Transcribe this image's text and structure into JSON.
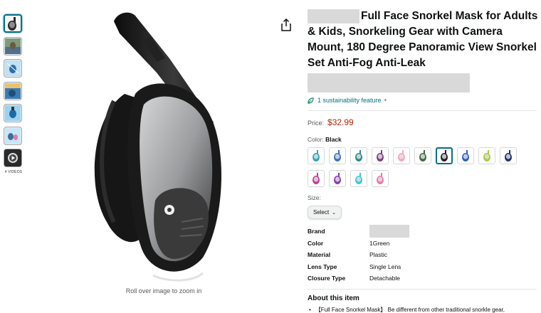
{
  "thumbnails": {
    "items": [
      {
        "name": "thumb-black-mask",
        "color": "#2b2b2b",
        "bg": "#f3f5f7"
      },
      {
        "name": "thumb-snorkeling-photo",
        "color": "#6b5a3d",
        "bg": "#7d9a7a"
      },
      {
        "name": "thumb-features-graphic",
        "color": "#2f6fb0",
        "bg": "#bfe1f2"
      },
      {
        "name": "thumb-underwater-photo",
        "color": "#1d4f7a",
        "bg": "#3c7bb0"
      },
      {
        "name": "thumb-camera-mount",
        "color": "#1b6aa6",
        "bg": "#9dd2ee"
      },
      {
        "name": "thumb-family-photo",
        "color": "#3b6f98",
        "bg": "#c8e6f5"
      }
    ],
    "videos_label": "4 VIDEOS"
  },
  "main_image": {
    "zoom_hint": "Roll over image to zoom in"
  },
  "product": {
    "title": "Full Face Snorkel Mask for Adults & Kids, Snorkeling Gear with Camera Mount, 180 Degree Panoramic View Snorkel Set Anti-Fog Anti-Leak",
    "sustainability": "1 sustainability feature",
    "price_label": "Price:",
    "price": "$32.99",
    "color_label": "Color:",
    "color_value": "Black",
    "size_label": "Size:",
    "size_select": "Select",
    "swatches": [
      {
        "name": "swatch-aqua",
        "color": "#2ea6b8"
      },
      {
        "name": "swatch-blue",
        "color": "#3f6fc2"
      },
      {
        "name": "swatch-teal-dark",
        "color": "#2f8c8c"
      },
      {
        "name": "swatch-purple-black",
        "color": "#7a3f7d"
      },
      {
        "name": "swatch-pink-light",
        "color": "#f2a7c6"
      },
      {
        "name": "swatch-green-black",
        "color": "#3d6b3d"
      },
      {
        "name": "swatch-black",
        "color": "#1f1f1f"
      },
      {
        "name": "swatch-royal-blue",
        "color": "#2d5fc4"
      },
      {
        "name": "swatch-lime",
        "color": "#a9cc3a"
      },
      {
        "name": "swatch-navy",
        "color": "#1f2d6b"
      },
      {
        "name": "swatch-magenta",
        "color": "#c23c9a"
      },
      {
        "name": "swatch-violet",
        "color": "#8a3cb0"
      },
      {
        "name": "swatch-cyan",
        "color": "#3cc8d4"
      },
      {
        "name": "swatch-pink",
        "color": "#e67aa8"
      }
    ],
    "specs": [
      {
        "key": "Brand",
        "value": ""
      },
      {
        "key": "Color",
        "value": "1Green"
      },
      {
        "key": "Material",
        "value": "Plastic"
      },
      {
        "key": "Lens Type",
        "value": "Single Lens"
      },
      {
        "key": "Closure Type",
        "value": "Detachable"
      }
    ],
    "about_title": "About this item",
    "about_items": [
      "【Full Face Snorkel Mask】 Be different from other traditional snorkle gear,"
    ]
  },
  "colors": {
    "price": "#b12704",
    "link": "#007185",
    "selected_border": "#007185"
  }
}
